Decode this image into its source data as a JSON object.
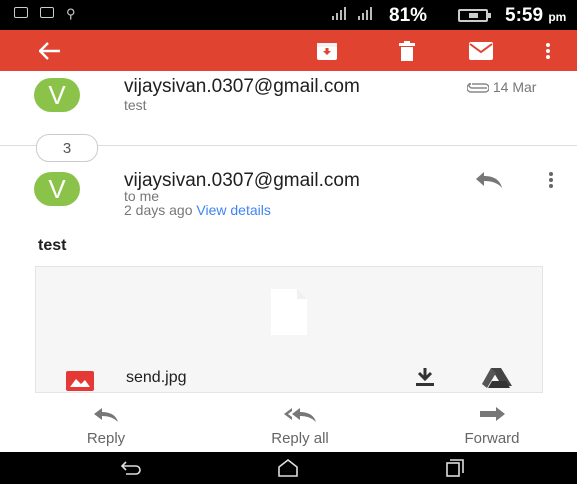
{
  "status_bar": {
    "battery": "81%",
    "time": "5:59",
    "time_suffix": "pm"
  },
  "app_bar": {
    "icons": [
      "back-arrow-icon",
      "archive-icon",
      "trash-icon",
      "mail-icon",
      "overflow-menu-icon"
    ]
  },
  "messages": [
    {
      "avatar": "V",
      "sender": "vijaysivan.0307@gmail.com",
      "preview": "test",
      "date": "14 Mar"
    },
    {
      "avatar": "V",
      "sender": "vijaysivan.0307@gmail.com",
      "recipient": "to me",
      "time": "2 days ago",
      "details_link": "View details",
      "body": "test"
    }
  ],
  "collapsed_count": "3",
  "attachment": {
    "file_name": "send.jpg"
  },
  "actions": {
    "reply": "Reply",
    "reply_all": "Reply all",
    "forward": "Forward"
  },
  "colors": {
    "app_bar": "#e0432f",
    "avatar": "#8bc34a",
    "link": "#3f84f4"
  }
}
